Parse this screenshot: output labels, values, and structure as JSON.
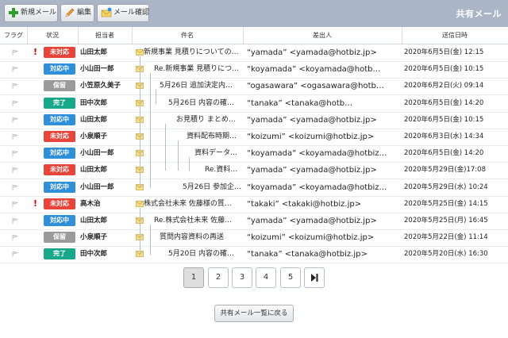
{
  "toolbar": {
    "new_label": "新規メール",
    "edit_label": "編集",
    "confirm_label": "メール確認",
    "page_title": "共有メール"
  },
  "columns": {
    "flag": "フラグ",
    "status": "状況",
    "assignee": "担当者",
    "subject": "件名",
    "sender": "差出人",
    "sent": "送信日時"
  },
  "status_colors": {
    "未対応": "#e8443a",
    "対応中": "#2f8fd8",
    "保留": "#9a9a9a",
    "完了": "#17a78a"
  },
  "rows": [
    {
      "important": true,
      "status": "未対応",
      "assignee": "山田太郎",
      "subject": "新規事業 見積りについての…",
      "sender": "“yamada” <yamada@hotbiz.jp>",
      "date": "2020年6月5日(金) 12:15"
    },
    {
      "important": false,
      "status": "対応中",
      "assignee": "小山田一郎",
      "subject": "Re.新規事業 見積りにつ…",
      "sender": "“koyamada” <koyamada@hotb…",
      "date": "2020年6月5日(金) 10:15"
    },
    {
      "important": false,
      "status": "保留",
      "assignee": "小笠原久美子",
      "subject": "5月26日 追加決定内…",
      "sender": "“ogasawara” <ogasawara@hotb…",
      "date": "2020年6月2日(火) 09:14"
    },
    {
      "important": false,
      "status": "完了",
      "assignee": "田中次郎",
      "subject": "5月26日 内容の確…",
      "sender": "“tanaka” <tanaka@hotb…",
      "date": "2020年6月5日(金) 14:20"
    },
    {
      "important": false,
      "status": "対応中",
      "assignee": "山田太郎",
      "subject": "お見積り まとめ…",
      "sender": "“yamada” <yamada@hotbiz.jp>",
      "date": "2020年6月5日(金) 10:15"
    },
    {
      "important": false,
      "status": "未対応",
      "assignee": "小泉順子",
      "subject": "資料配布時期…",
      "sender": "“koizumi” <koizumi@hotbiz.jp>",
      "date": "2020年6月3日(水) 14:34"
    },
    {
      "important": false,
      "status": "対応中",
      "assignee": "小山田一郎",
      "subject": "資料データ…",
      "sender": "“koyamada” <koyamada@hotbiz…",
      "date": "2020年6月5日(金) 14:20"
    },
    {
      "important": false,
      "status": "未対応",
      "assignee": "山田太郎",
      "subject": "Re.資料…",
      "sender": "“yamada” <yamada@hotbiz.jp>",
      "date": "2020年5月29日(金)17:08"
    },
    {
      "important": false,
      "status": "対応中",
      "assignee": "小山田一郎",
      "subject": "5月26日 参加企…",
      "sender": "“koyamada” <koyamada@hotbiz…",
      "date": "2020年5月29日(水) 10:24"
    },
    {
      "important": true,
      "status": "未対応",
      "assignee": "高木治",
      "subject": "株式会社未来 佐藤様の質…",
      "sender": "“takaki” <takaki@hotbiz.jp>",
      "date": "2020年5月25日(金) 14:15"
    },
    {
      "important": false,
      "status": "対応中",
      "assignee": "山田太郎",
      "subject": "Re.株式会社未来 佐藤…",
      "sender": "“yamada” <yamada@hotbiz.jp>",
      "date": "2020年5月25日(月) 16:45"
    },
    {
      "important": false,
      "status": "保留",
      "assignee": "小泉順子",
      "subject": "質問内容資料の再送",
      "sender": "“koizumi” <koizumi@hotbiz.jp>",
      "date": "2020年5月22日(金) 11:14"
    },
    {
      "important": false,
      "status": "完了",
      "assignee": "田中次郎",
      "subject": "5月20日 内容の確…",
      "sender": "“tanaka” <tanaka@hotbiz.jp>",
      "date": "2020年5月20日(水) 16:30"
    }
  ],
  "pagination": {
    "pages": [
      "1",
      "2",
      "3",
      "4",
      "5"
    ],
    "current": "1",
    "last_icon": "skip-to-last-icon"
  },
  "back_label": "共有メール一覧に戻る"
}
